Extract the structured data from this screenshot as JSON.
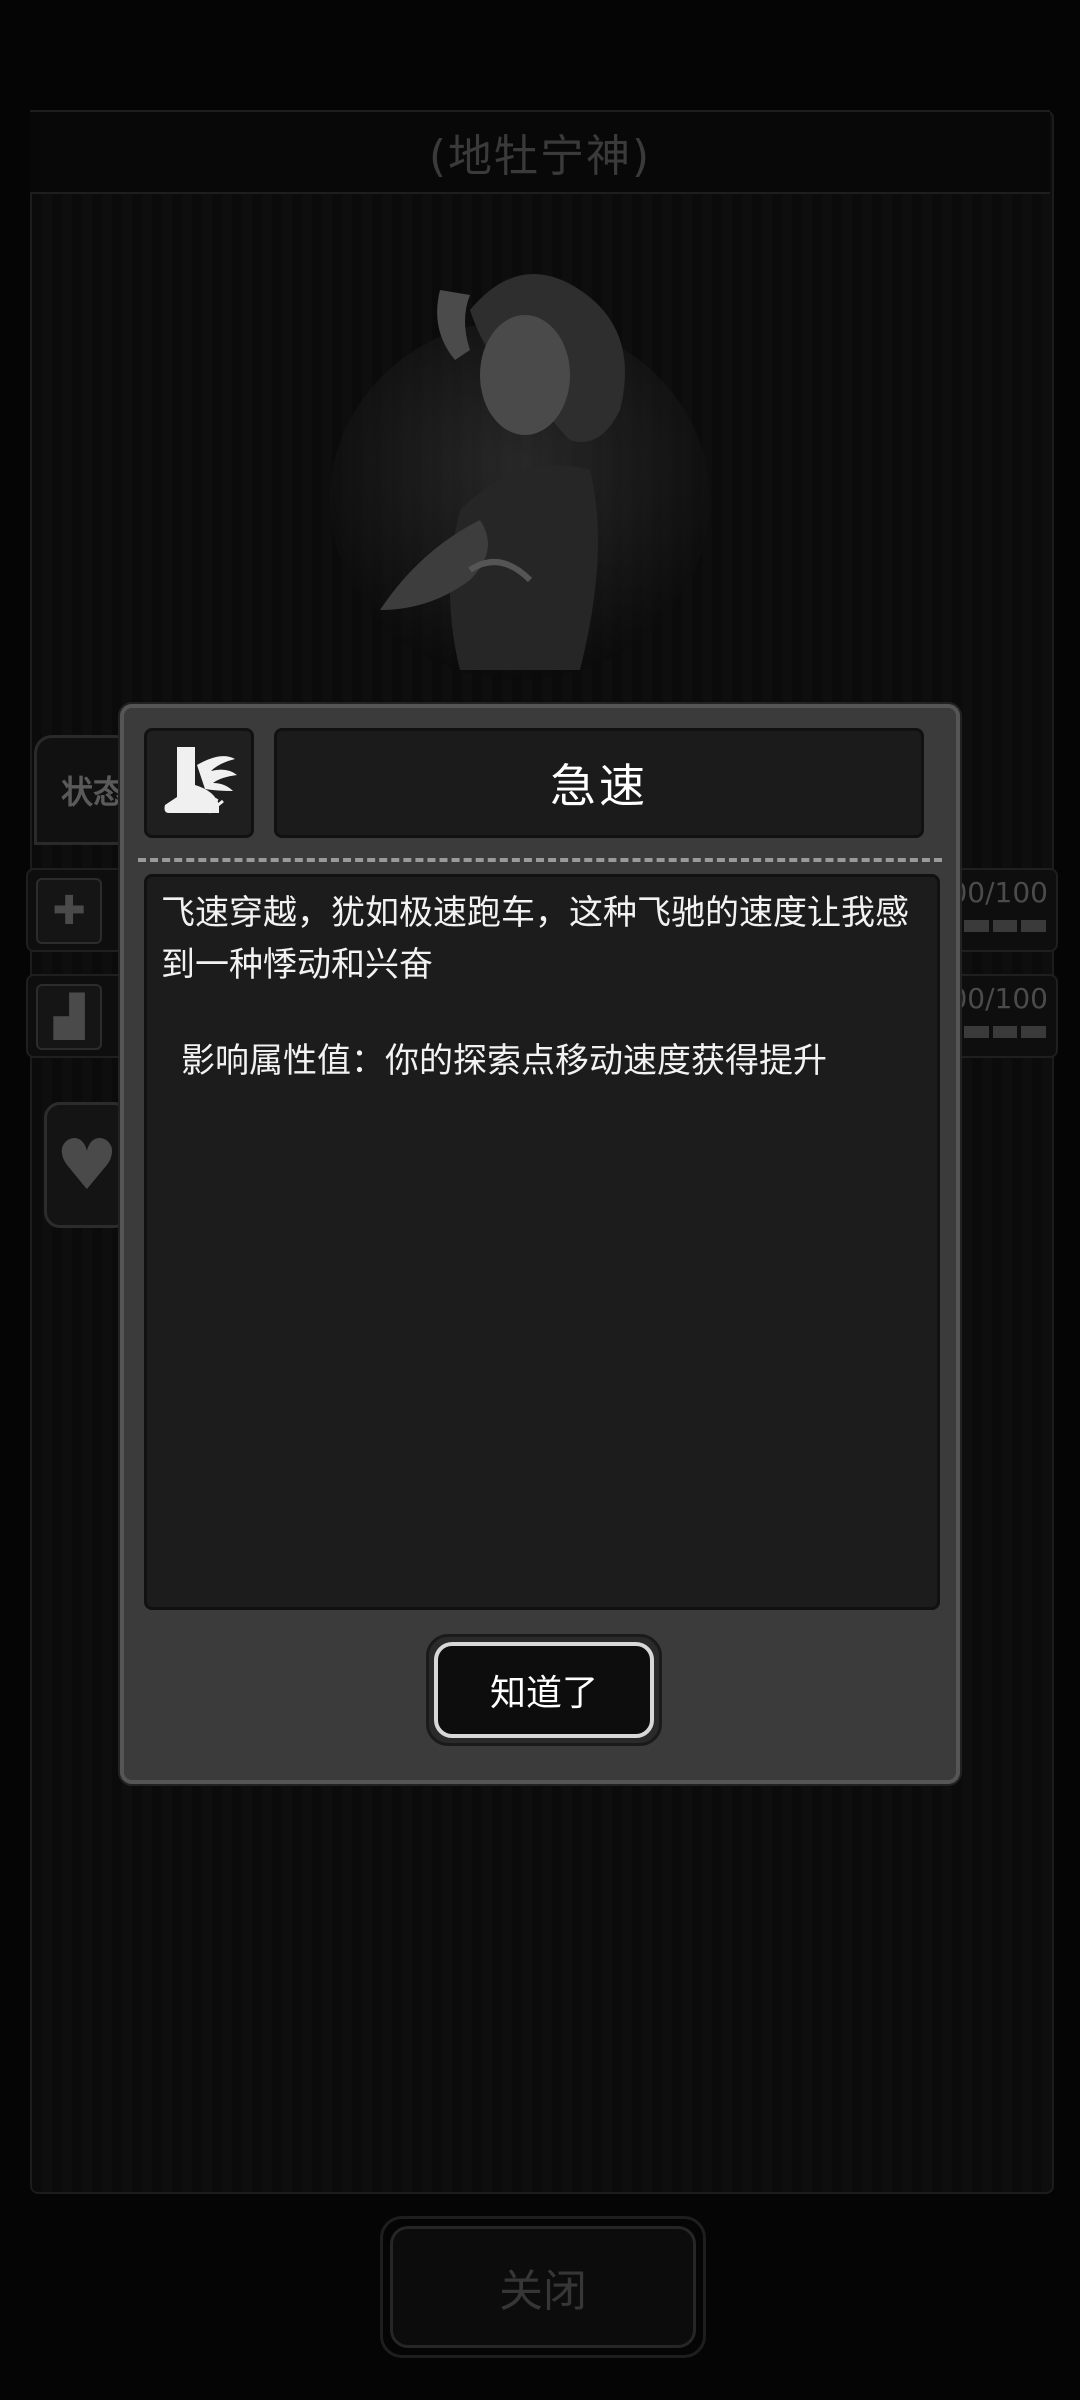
{
  "background": {
    "title": "(地牡宁神)",
    "tab_label": "状态",
    "rows": [
      {
        "icon": "first-aid-kit-icon",
        "value": "100/100"
      },
      {
        "icon": "boot-icon",
        "value": "100/100"
      }
    ],
    "heart_icon": "heart-icon",
    "close_label": "关闭"
  },
  "dialog": {
    "icon": "winged-boot-icon",
    "title": "急速",
    "description": "飞速穿越，犹如极速跑车，这种飞驰的速度让我感到一种悸动和兴奋",
    "effect": "影响属性值：你的探索点移动速度获得提升",
    "ok_label": "知道了"
  },
  "colors": {
    "dialog_bg": "#3b3b3b",
    "panel_bg": "#1c1c1c",
    "text": "#ffffff"
  }
}
